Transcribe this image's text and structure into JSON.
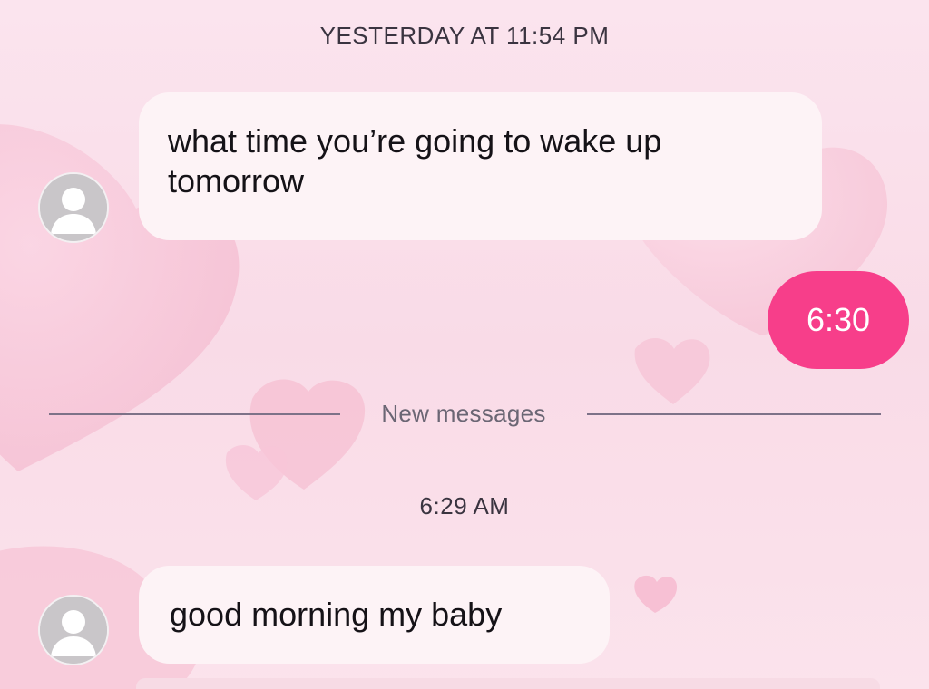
{
  "conversation": {
    "timestamp_1": "YESTERDAY AT 11:54 PM",
    "messages": [
      {
        "direction": "incoming",
        "text": "what time you’re going to wake up tomorrow"
      },
      {
        "direction": "outgoing",
        "text": "6:30"
      },
      {
        "direction": "incoming",
        "text": "good morning my baby"
      }
    ],
    "divider_label": "New messages",
    "timestamp_2": "6:29 AM"
  },
  "colors": {
    "background": "#fbe4ee",
    "incoming_bubble": "#fdf3f6",
    "outgoing_bubble": "#f73e8a",
    "divider": "#7d7288"
  },
  "icons": {
    "avatar": "default-avatar-icon",
    "background": "heart-shapes"
  }
}
